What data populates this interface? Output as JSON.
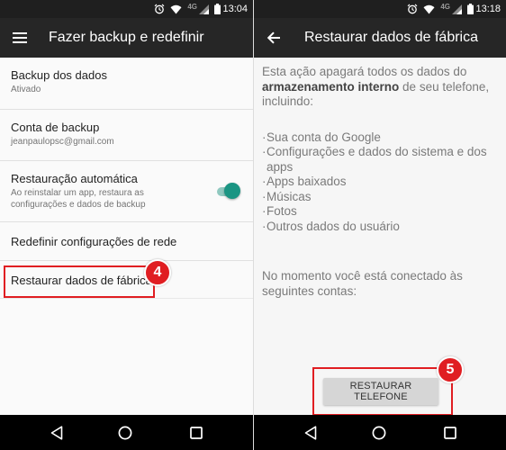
{
  "left": {
    "status": {
      "network": "4G",
      "time": "13:04"
    },
    "appbar": {
      "title": "Fazer backup e redefinir",
      "icon": "menu-icon"
    },
    "items": [
      {
        "title": "Backup dos dados",
        "subtitle": "Ativado"
      },
      {
        "title": "Conta de backup",
        "subtitle": "jeanpaulopsc@gmail.com"
      },
      {
        "title": "Restauração automática",
        "subtitle": "Ao reinstalar um app, restaura as configurações e dados de backup",
        "toggle_on": true
      },
      {
        "title": "Redefinir configurações de rede"
      },
      {
        "title": "Restaurar dados de fábrica"
      }
    ],
    "step_badge": "4"
  },
  "right": {
    "status": {
      "network": "4G",
      "time": "13:18"
    },
    "appbar": {
      "title": "Restaurar dados de fábrica",
      "icon": "back-arrow-icon"
    },
    "intro": {
      "before": "Esta ação apagará todos os dados do ",
      "bold": "armazenamento interno",
      "after": " de seu telefone, incluindo:"
    },
    "bullets": [
      "Sua conta do Google",
      "Configurações e dados do sistema e dos apps",
      "Apps baixados",
      "Músicas",
      "Fotos",
      "Outros dados do usuário"
    ],
    "connected_text": "No momento você está conectado às seguintes contas:",
    "button_label": "RESTAURAR TELEFONE",
    "step_badge": "5"
  },
  "colors": {
    "accent": "#1b9583",
    "highlight": "#e01e22",
    "appbar": "#262626"
  }
}
